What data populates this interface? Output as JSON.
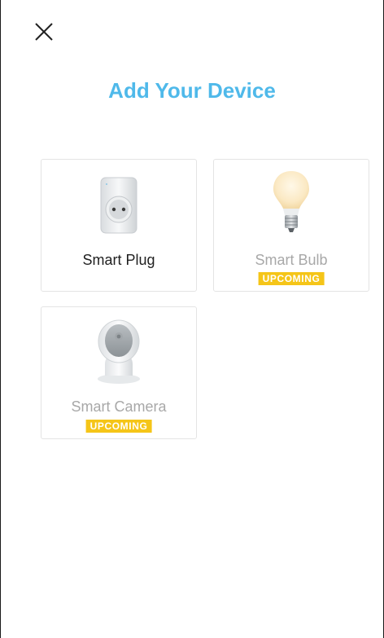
{
  "header": {
    "close_icon": "close-icon",
    "title": "Add Your Device",
    "title_color": "#4fb9ea"
  },
  "devices": [
    {
      "label": "Smart Plug",
      "status": "",
      "icon": "smart-plug-icon",
      "available": true
    },
    {
      "label": "Smart Bulb",
      "status": "UPCOMING",
      "icon": "smart-bulb-icon",
      "available": false
    },
    {
      "label": "Smart Camera",
      "status": "UPCOMING",
      "icon": "smart-camera-icon",
      "available": false
    }
  ],
  "colors": {
    "badge": "#f5c518",
    "label_active": "#1f1f1f",
    "label_muted": "#a8a8a8"
  }
}
